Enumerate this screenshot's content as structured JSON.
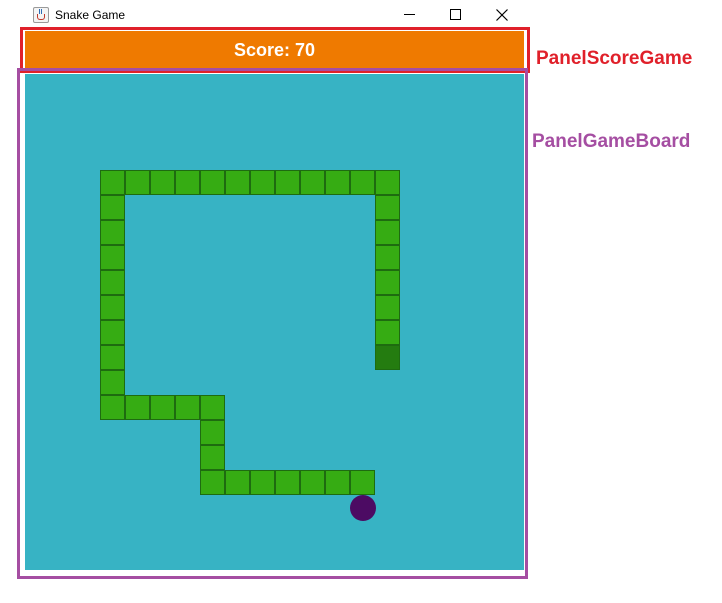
{
  "window": {
    "title": "Snake Game",
    "icon": "java-cup-icon"
  },
  "score_panel": {
    "label": "Score: 70",
    "color": "#ef7a00"
  },
  "game_board": {
    "color": "#37b3c4",
    "snake_color": "#36ac13",
    "tail_color": "#247c10",
    "food_color": "#4c0b63",
    "snake": [
      [
        14,
        8
      ],
      [
        14,
        7
      ],
      [
        14,
        6
      ],
      [
        14,
        5
      ],
      [
        14,
        4
      ],
      [
        14,
        3
      ],
      [
        14,
        2
      ],
      [
        14,
        1
      ],
      [
        13,
        1
      ],
      [
        12,
        1
      ],
      [
        11,
        1
      ],
      [
        10,
        1
      ],
      [
        9,
        1
      ],
      [
        8,
        1
      ],
      [
        7,
        1
      ],
      [
        6,
        1
      ],
      [
        5,
        1
      ],
      [
        4,
        1
      ],
      [
        3,
        1
      ],
      [
        3,
        2
      ],
      [
        3,
        3
      ],
      [
        3,
        4
      ],
      [
        3,
        5
      ],
      [
        3,
        6
      ],
      [
        3,
        7
      ],
      [
        3,
        8
      ],
      [
        3,
        9
      ],
      [
        3,
        10
      ],
      [
        4,
        10
      ],
      [
        5,
        10
      ],
      [
        6,
        10
      ],
      [
        7,
        10
      ],
      [
        7,
        11
      ],
      [
        7,
        12
      ],
      [
        7,
        13
      ],
      [
        8,
        13
      ],
      [
        9,
        13
      ],
      [
        10,
        13
      ],
      [
        11,
        13
      ],
      [
        12,
        13
      ],
      [
        13,
        13
      ]
    ],
    "food": [
      13,
      14
    ]
  },
  "annotations": {
    "score_label": "PanelScoreGame",
    "board_label": "PanelGameBoard",
    "score_color": "#e0202a",
    "board_color": "#a54ea2"
  }
}
